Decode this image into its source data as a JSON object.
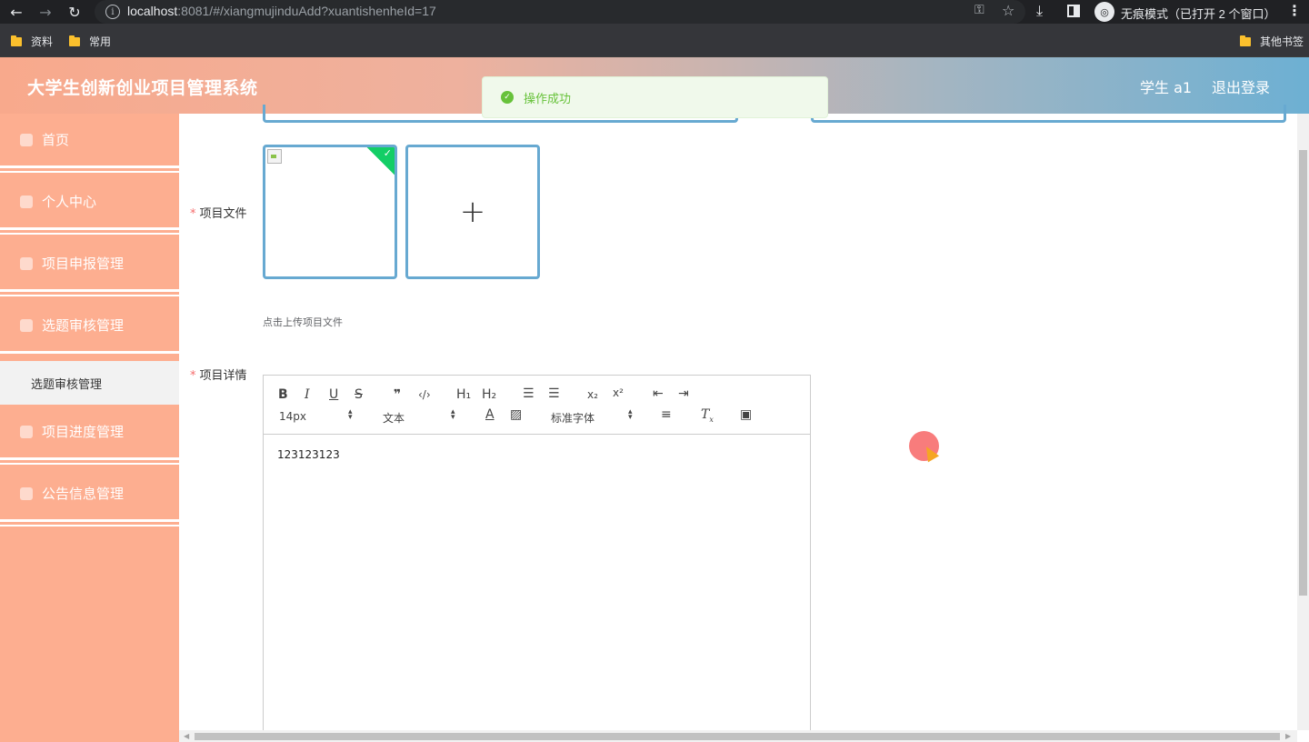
{
  "browser": {
    "url_host": "localhost",
    "url_rest": ":8081/#/xiangmujinduAdd?xuantishenheId=17",
    "incognito_text": "无痕模式（已打开 2 个窗口）",
    "bookmarks": [
      "资料",
      "常用"
    ],
    "other_bookmarks": "其他书签"
  },
  "header": {
    "title": "大学生创新创业项目管理系统",
    "user": "学生 a1",
    "logout": "退出登录"
  },
  "sidebar": {
    "items": [
      {
        "label": "首页",
        "icon": "home-icon"
      },
      {
        "label": "个人中心",
        "icon": "user-icon"
      },
      {
        "label": "项目申报管理",
        "icon": "menu-icon"
      },
      {
        "label": "选题审核管理",
        "icon": "list-icon"
      },
      {
        "label": "项目进度管理",
        "icon": "grid-icon"
      },
      {
        "label": "公告信息管理",
        "icon": "grid-icon"
      }
    ],
    "sub_item": "选题审核管理"
  },
  "form": {
    "file_label": "项目文件",
    "upload_tip": "点击上传项目文件",
    "detail_label": "项目详情"
  },
  "editor": {
    "toolbar_row1": [
      "B",
      "I",
      "U",
      "S",
      "99",
      "</>",
      "H1",
      "H2",
      "ol",
      "ul",
      "x2",
      "x²",
      "outdent",
      "indent"
    ],
    "size_value": "14px",
    "header_value": "文本",
    "font_value": "标准字体",
    "content": "123123123"
  },
  "toast": {
    "message": "操作成功"
  }
}
